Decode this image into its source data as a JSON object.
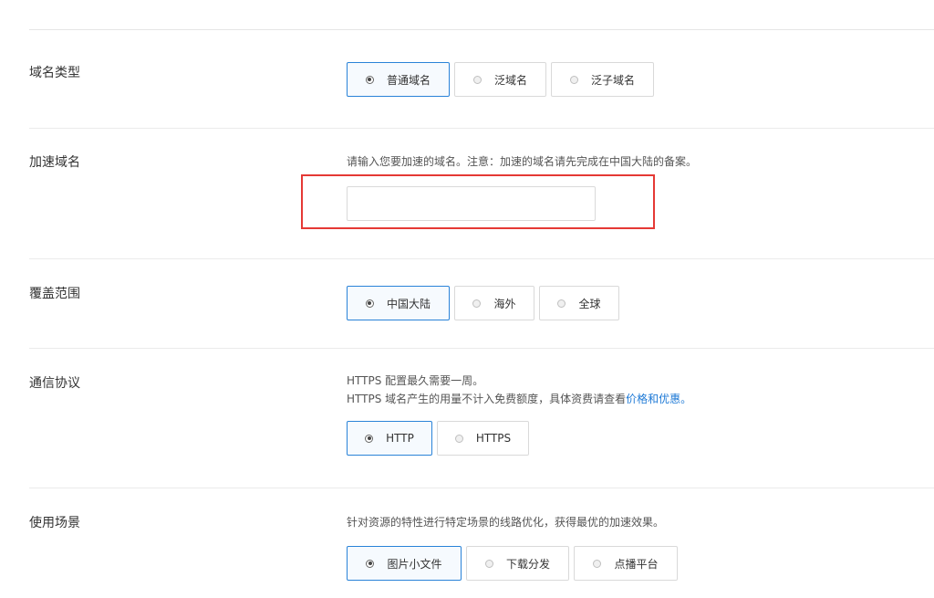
{
  "domain_type": {
    "label": "域名类型",
    "options": [
      "普通域名",
      "泛域名",
      "泛子域名"
    ],
    "selected": "普通域名"
  },
  "accel_domain": {
    "label": "加速域名",
    "hint": "请输入您要加速的域名。注意：加速的域名请先完成在中国大陆的备案。",
    "value": "",
    "placeholder": ""
  },
  "coverage": {
    "label": "覆盖范围",
    "options": [
      "中国大陆",
      "海外",
      "全球"
    ],
    "selected": "中国大陆"
  },
  "protocol": {
    "label": "通信协议",
    "hint1": "HTTPS 配置最久需要一周。",
    "hint2_prefix": "HTTPS 域名产生的用量不计入免费额度，具体资费请查看",
    "hint2_link": "价格和优惠。",
    "options": [
      "HTTP",
      "HTTPS"
    ],
    "selected": "HTTP"
  },
  "scenario": {
    "label": "使用场景",
    "hint": "针对资源的特性进行特定场景的线路优化，获得最优的加速效果。",
    "options": [
      "图片小文件",
      "下载分发",
      "点播平台"
    ],
    "selected": "图片小文件"
  },
  "colors": {
    "selected_border": "#2a83d8",
    "link": "#1f7ad6",
    "highlight": "#e53935"
  }
}
